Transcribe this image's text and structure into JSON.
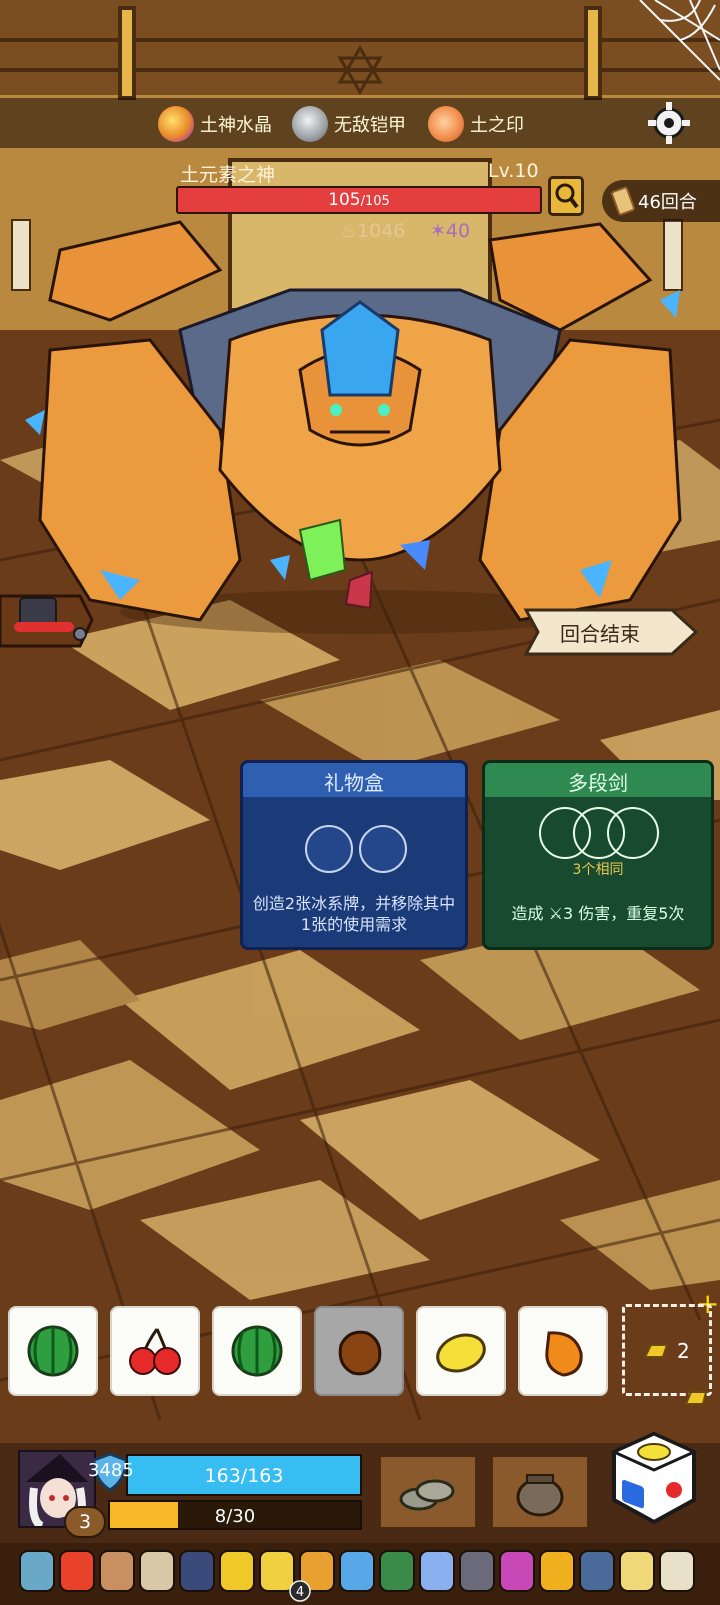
{
  "buffs": [
    {
      "icon": "earth-crystal-icon",
      "label": "土神水晶"
    },
    {
      "icon": "invincible-armor-icon",
      "label": "无敌铠甲"
    },
    {
      "icon": "earth-seal-icon",
      "label": "土之印"
    }
  ],
  "boss": {
    "name": "土元素之神",
    "level": "Lv.10",
    "hp_current": "105",
    "hp_max": "/105",
    "hp_fraction": 1.0,
    "intent_attack": "1046",
    "intent_debuff": "40"
  },
  "round_counter": "46回合",
  "end_turn_label": "回合结束",
  "cards": [
    {
      "title": "礼物盒",
      "description": "创造2张冰系牌，并移除其中1张的使用需求",
      "color": "#1b3a78"
    },
    {
      "title": "多段剑",
      "requirement": "3个相同",
      "description": "造成 ⚔3 伤害，重复5次",
      "color": "#174a2e"
    }
  ],
  "dice": [
    {
      "icon": "watermelon-icon",
      "used": false
    },
    {
      "icon": "cherry-icon",
      "used": false
    },
    {
      "icon": "watermelon-icon",
      "used": false
    },
    {
      "icon": "coconut-icon",
      "used": true
    },
    {
      "icon": "lemon-icon",
      "used": false
    },
    {
      "icon": "mango-icon",
      "used": false
    }
  ],
  "extra_slot": {
    "icon": "gold-bar-icon",
    "count": "2"
  },
  "player": {
    "shield": "3485",
    "hp": "163/163",
    "level": "3",
    "xp": "8/30",
    "xp_fraction": 0.27
  },
  "relic_badge_count": "4",
  "colors": {
    "hp_red": "#e43e3e",
    "hp_blue": "#38bdf2",
    "xp_gold": "#f6b826"
  }
}
